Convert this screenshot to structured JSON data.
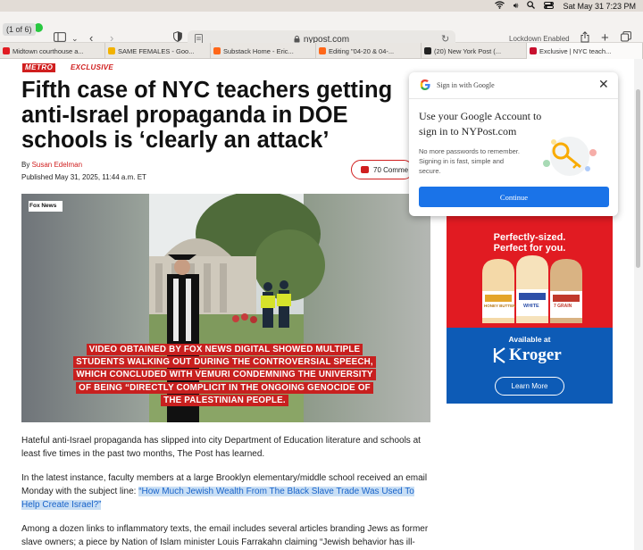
{
  "menubar": {
    "datetime": "Sat May 31  7:23 PM"
  },
  "toolbar": {
    "tab_counter": "(1 of 6)",
    "url": "nypost.com",
    "lockdown": "Lockdown Enabled"
  },
  "tabs": [
    {
      "label": "Midtown courthouse a...",
      "color": "#e11b22"
    },
    {
      "label": "SAME FEMALES - Goo...",
      "color": "#f2b200"
    },
    {
      "label": "Substack Home - Eric...",
      "color": "#ff6719"
    },
    {
      "label": "Editing \"04-20 & 04-...",
      "color": "#ff6719"
    },
    {
      "label": "(20) New York Post (...",
      "color": "#1da1f2"
    },
    {
      "label": "Exclusive | NYC teach...",
      "color": "#c8102e"
    }
  ],
  "article": {
    "section": "METRO",
    "tag": "EXCLUSIVE",
    "headline": "Fifth case of NYC teachers getting anti-Israel propaganda in DOE schools is ‘clearly an attack’",
    "byline_prefix": "By ",
    "author": "Susan Edelman",
    "published": "Published May 31, 2025, 11:44 a.m. ET",
    "comments": "70 Comme",
    "video": {
      "badge": "Fox News",
      "caption": "VIDEO OBTAINED BY FOX NEWS DIGITAL SHOWED MULTIPLE STUDENTS WALKING OUT DURING THE CONTROVERSIAL SPEECH, WHICH CONCLUDED WITH VEMURI CONDEMNING THE UNIVERSITY OF BEING “DIRECTLY COMPLICIT IN THE ONGOING GENOCIDE OF THE PALESTINIAN PEOPLE."
    },
    "p1": "Hateful anti-Israel propaganda has slipped into city Department of Education literature and schools at least five times in the past two months, The Post has learned.",
    "p2_pre": "In the latest instance, faculty members at a large Brooklyn elementary/middle school received an email Monday with the subject line: ",
    "p2_highlight": "“How Much Jewish Wealth From The Black Slave Trade Was Used To Help Create Israel?”",
    "p3": "Among a dozen links to inflammatory texts, the email includes several articles branding Jews as former slave owners; a piece by Nation of Islam minister Louis Farrakahn claiming “Jewish behavior has ill-"
  },
  "ad": {
    "line1": "Perfectly-sized.",
    "line2": "Perfect for you.",
    "available": "Available at",
    "brand": "Kroger",
    "cta": "Learn More",
    "bread_labels": [
      "HONEY BUTTER",
      "WHITE",
      "7 GRAIN"
    ]
  },
  "google_popup": {
    "title": "Sign in with Google",
    "heading": "Use your Google Account to sign in to NYPost.com",
    "sub": "No more passwords to remember. Signing in is fast, simple and secure.",
    "button": "Continue"
  }
}
